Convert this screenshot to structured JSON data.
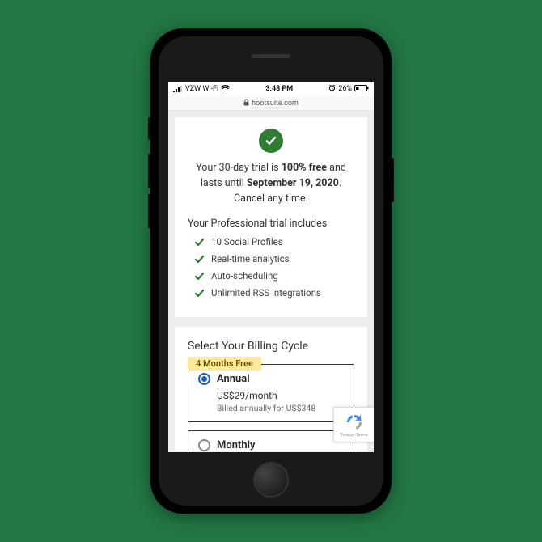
{
  "statusbar": {
    "carrier": "VZW Wi-Fi",
    "time": "3:48 PM",
    "battery": "26%"
  },
  "addressbar": {
    "domain": "hootsuite.com"
  },
  "trial": {
    "line1_pre": "Your 30-day trial is ",
    "line1_bold": "100% free",
    "line1_post": " and",
    "line2_pre": "lasts until ",
    "line2_bold": "September 19, 2020",
    "line2_post": ".",
    "line3": "Cancel any time."
  },
  "includes": {
    "title": "Your Professional trial includes",
    "items": [
      "10 Social Profiles",
      "Real-time analytics",
      "Auto-scheduling",
      "Unlimited RSS integrations"
    ]
  },
  "billing": {
    "title": "Select Your Billing Cycle",
    "badge": "4 Months Free",
    "annual": {
      "label": "Annual",
      "price": "US$29/month",
      "billed": "Billed annually for US$348"
    },
    "monthly": {
      "label": "Monthly"
    }
  },
  "recaptcha": {
    "label": "Privacy - Terms"
  }
}
